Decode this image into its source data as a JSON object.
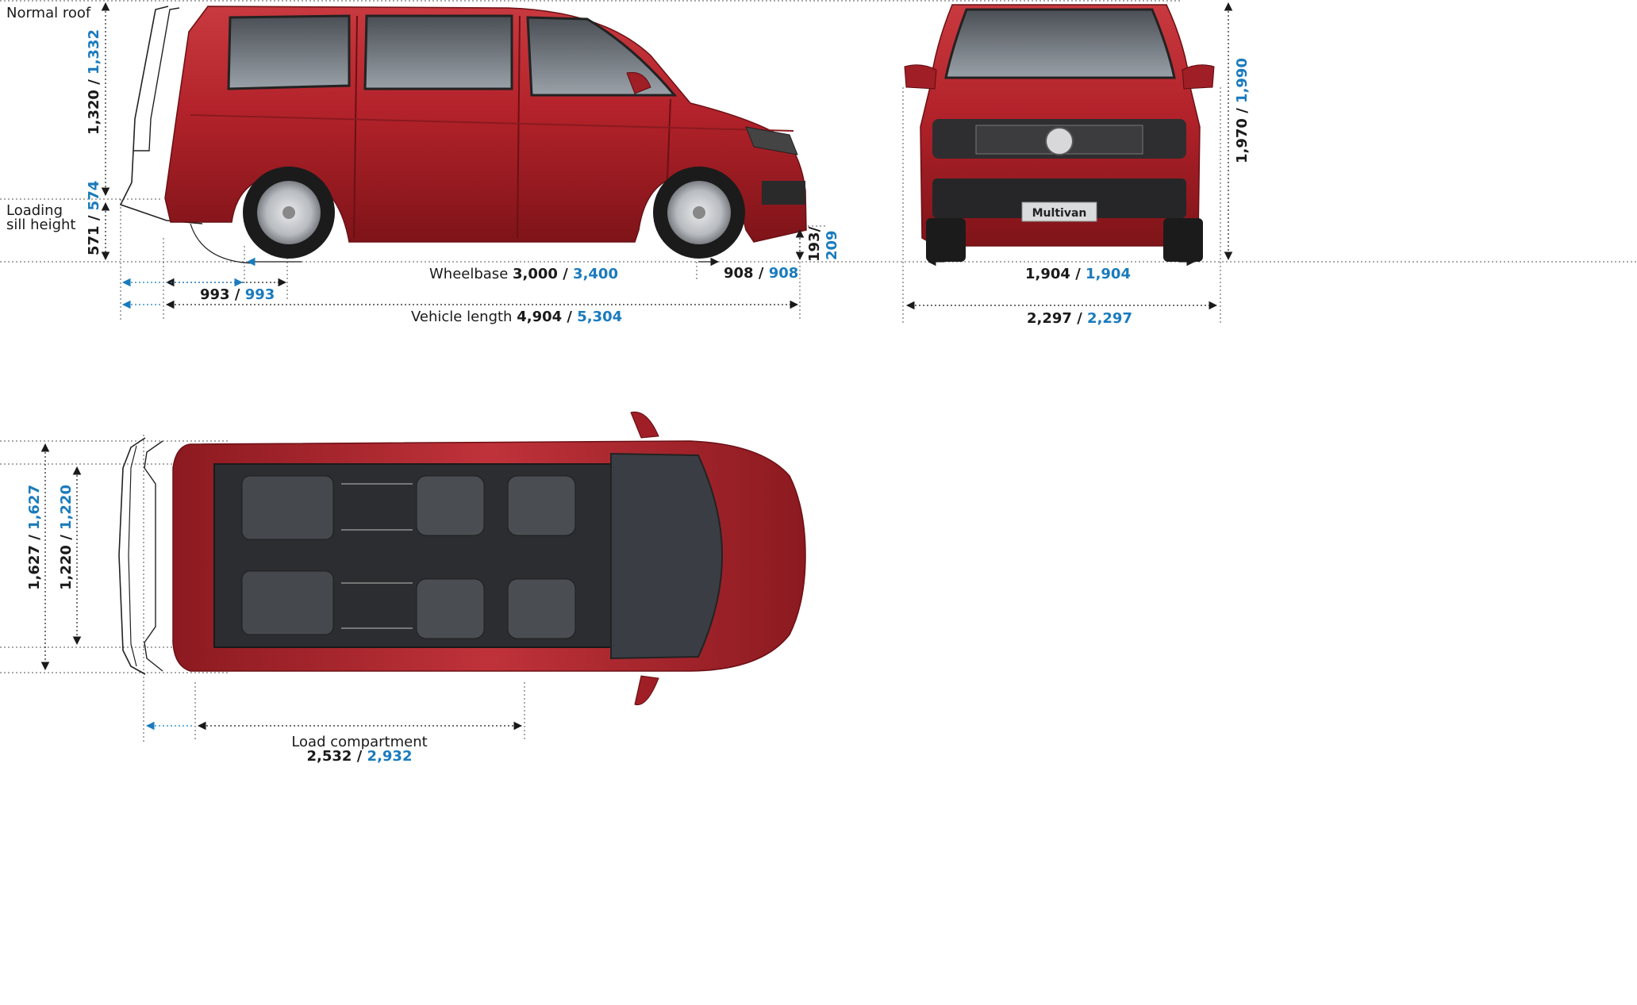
{
  "colors": {
    "body_red": "#b3222a",
    "accent_blue": "#1a7bbd",
    "text": "#1a1a1a"
  },
  "side": {
    "roof_label": "Normal roof",
    "height": {
      "a": "1,320",
      "sep": " / ",
      "b": "1,332"
    },
    "sill_label_1": "Loading",
    "sill_label_2": "sill height",
    "sill": {
      "a": "571",
      "sep": " / ",
      "b": "574"
    },
    "rear_overhang": {
      "a": "993",
      "sep": " / ",
      "b": "993"
    },
    "wheelbase": {
      "prefix": "Wheelbase ",
      "a": "3,000",
      "sep": " / ",
      "b": "3,400"
    },
    "front_overhang": {
      "a": "908",
      "sep": " / ",
      "b": "908"
    },
    "ground_clearance": {
      "a": "193/",
      "b": "209"
    },
    "length": {
      "prefix": "Vehicle length ",
      "a": "4,904",
      "sep": " / ",
      "b": "5,304"
    }
  },
  "front": {
    "plate": "Multivan",
    "height": {
      "a": "1,970",
      "sep": " / ",
      "b": "1,990"
    },
    "track": {
      "a": "1,904",
      "sep": " / ",
      "b": "1,904"
    },
    "width": {
      "a": "2,297",
      "sep": " / ",
      "b": "2,297"
    }
  },
  "top": {
    "outer_width": {
      "a": "1,627",
      "sep": " / ",
      "b": "1,627"
    },
    "inner_width": {
      "a": "1,220",
      "sep": " / ",
      "b": "1,220"
    },
    "load_label": "Load compartment",
    "load": {
      "a": "2,532",
      "sep": " / ",
      "b": "2,932"
    }
  }
}
